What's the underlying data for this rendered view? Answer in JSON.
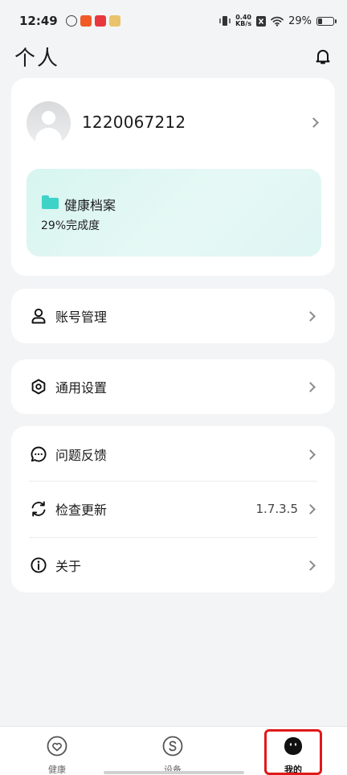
{
  "status_bar": {
    "time": "12:49",
    "net_speed_value": "0.40",
    "net_speed_unit": "KB/s",
    "battery": "29%",
    "battery_level": 0.29
  },
  "header": {
    "title": "个人"
  },
  "profile": {
    "user_id": "1220067212",
    "health_record": {
      "title": "健康档案",
      "progress": "29%完成度"
    }
  },
  "menu": {
    "account": {
      "label": "账号管理"
    },
    "settings": {
      "label": "通用设置"
    },
    "feedback": {
      "label": "问题反馈"
    },
    "update": {
      "label": "检查更新",
      "version": "1.7.3.5"
    },
    "about": {
      "label": "关于"
    }
  },
  "bottom_nav": [
    {
      "label": "健康"
    },
    {
      "label": "设备"
    },
    {
      "label": "我的"
    }
  ],
  "colors": {
    "accent_teal": "#3fd3c7",
    "highlight_red": "#e01919"
  }
}
